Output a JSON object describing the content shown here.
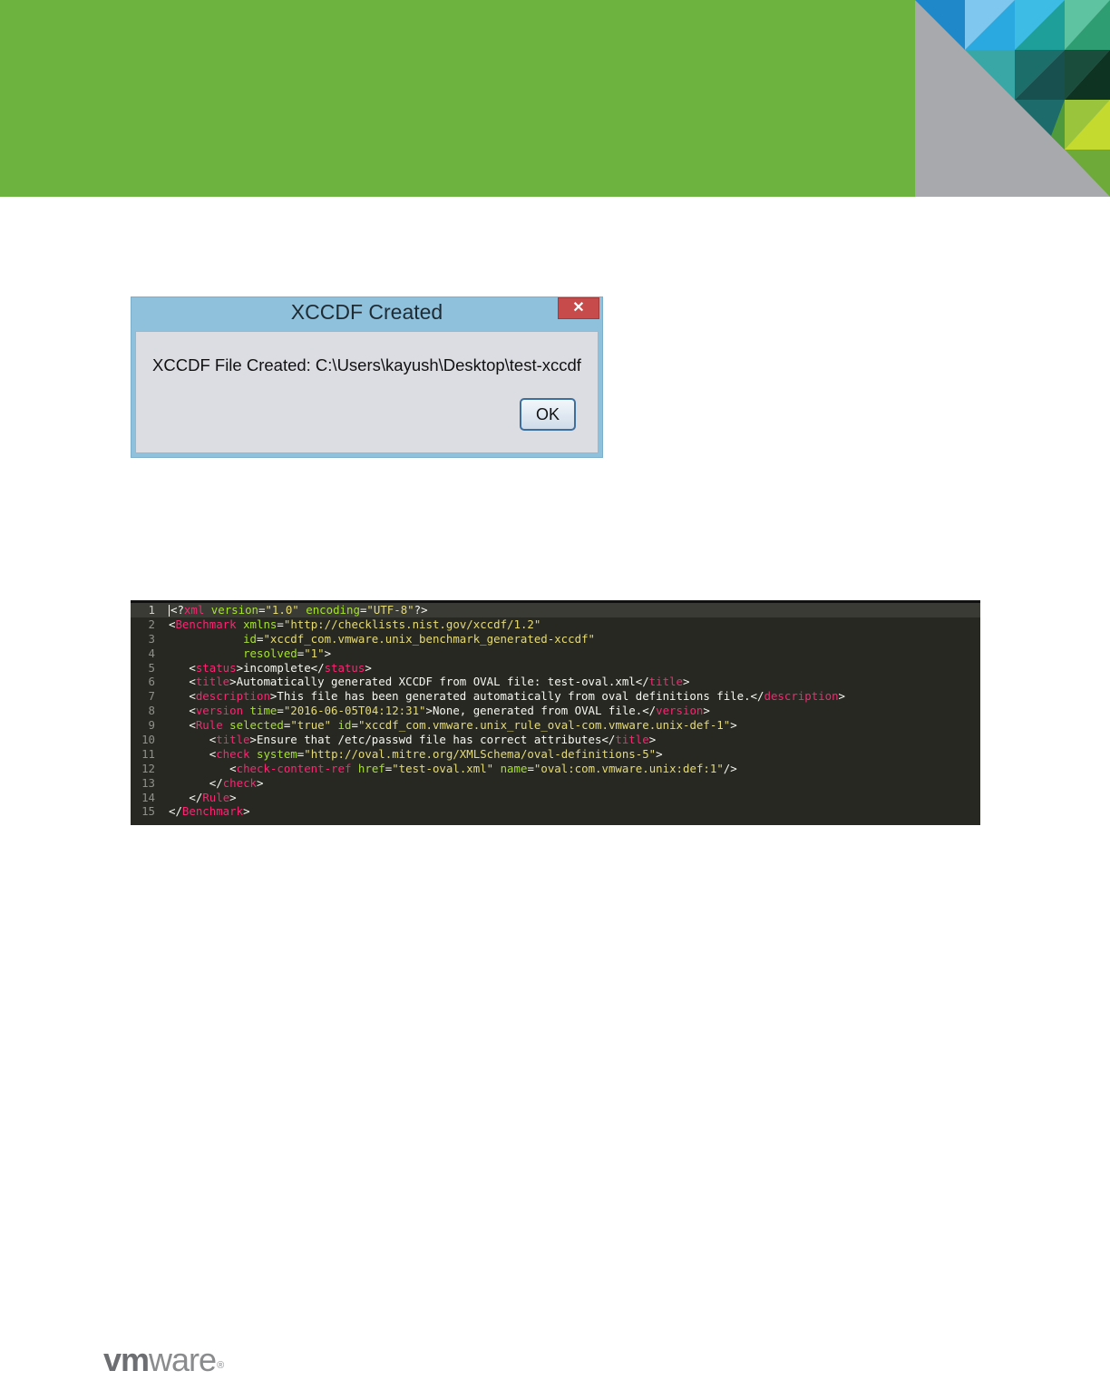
{
  "dialog": {
    "title": "XCCDF Created",
    "close_glyph": "✕",
    "message": "XCCDF File Created: C:\\Users\\kayush\\Desktop\\test-xccdf",
    "ok_label": "OK"
  },
  "code": {
    "active_line": 1,
    "lines": [
      {
        "n": "1",
        "tokens": [
          [
            "p",
            "<?"
          ],
          [
            "g",
            "xml"
          ],
          [
            "p",
            " "
          ],
          [
            "a",
            "version"
          ],
          [
            "p",
            "="
          ],
          [
            "s",
            "\"1.0\""
          ],
          [
            "p",
            " "
          ],
          [
            "a",
            "encoding"
          ],
          [
            "p",
            "="
          ],
          [
            "s",
            "\"UTF-8\""
          ],
          [
            "p",
            "?>"
          ]
        ]
      },
      {
        "n": "2",
        "tokens": [
          [
            "p",
            "<"
          ],
          [
            "t",
            "Benchmark"
          ],
          [
            "p",
            " "
          ],
          [
            "a",
            "xmlns"
          ],
          [
            "p",
            "="
          ],
          [
            "s",
            "\"http://checklists.nist.gov/xccdf/1.2\""
          ]
        ]
      },
      {
        "n": "3",
        "tokens": [
          [
            "p",
            "           "
          ],
          [
            "a",
            "id"
          ],
          [
            "p",
            "="
          ],
          [
            "s",
            "\"xccdf_com.vmware.unix_benchmark_generated-xccdf\""
          ]
        ]
      },
      {
        "n": "4",
        "tokens": [
          [
            "p",
            "           "
          ],
          [
            "a",
            "resolved"
          ],
          [
            "p",
            "="
          ],
          [
            "s",
            "\"1\""
          ],
          [
            "p",
            ">"
          ]
        ]
      },
      {
        "n": "5",
        "tokens": [
          [
            "p",
            "   <"
          ],
          [
            "t",
            "status"
          ],
          [
            "p",
            ">incomplete</"
          ],
          [
            "t",
            "status"
          ],
          [
            "p",
            ">"
          ]
        ]
      },
      {
        "n": "6",
        "tokens": [
          [
            "p",
            "   <"
          ],
          [
            "t",
            "title"
          ],
          [
            "p",
            ">Automatically generated XCCDF from OVAL file: test-oval.xml</"
          ],
          [
            "t",
            "title"
          ],
          [
            "p",
            ">"
          ]
        ]
      },
      {
        "n": "7",
        "tokens": [
          [
            "p",
            "   <"
          ],
          [
            "t",
            "description"
          ],
          [
            "p",
            ">This file has been generated automatically from oval definitions file.</"
          ],
          [
            "t",
            "description"
          ],
          [
            "p",
            ">"
          ]
        ]
      },
      {
        "n": "8",
        "tokens": [
          [
            "p",
            "   <"
          ],
          [
            "t",
            "version"
          ],
          [
            "p",
            " "
          ],
          [
            "a",
            "time"
          ],
          [
            "p",
            "="
          ],
          [
            "s",
            "\"2016-06-05T04:12:31\""
          ],
          [
            "p",
            ">None, generated from OVAL file.</"
          ],
          [
            "t",
            "version"
          ],
          [
            "p",
            ">"
          ]
        ]
      },
      {
        "n": "9",
        "tokens": [
          [
            "p",
            "   <"
          ],
          [
            "t",
            "Rule"
          ],
          [
            "p",
            " "
          ],
          [
            "a",
            "selected"
          ],
          [
            "p",
            "="
          ],
          [
            "s",
            "\"true\""
          ],
          [
            "p",
            " "
          ],
          [
            "a",
            "id"
          ],
          [
            "p",
            "="
          ],
          [
            "s",
            "\"xccdf_com.vmware.unix_rule_oval-com.vmware.unix-def-1\""
          ],
          [
            "p",
            ">"
          ]
        ]
      },
      {
        "n": "10",
        "tokens": [
          [
            "p",
            "      <"
          ],
          [
            "t",
            "title"
          ],
          [
            "p",
            ">Ensure that /etc/passwd file has correct attributes</"
          ],
          [
            "t",
            "title"
          ],
          [
            "p",
            ">"
          ]
        ]
      },
      {
        "n": "11",
        "tokens": [
          [
            "p",
            "      <"
          ],
          [
            "t",
            "check"
          ],
          [
            "p",
            " "
          ],
          [
            "a",
            "system"
          ],
          [
            "p",
            "="
          ],
          [
            "s",
            "\"http://oval.mitre.org/XMLSchema/oval-definitions-5\""
          ],
          [
            "p",
            ">"
          ]
        ]
      },
      {
        "n": "12",
        "tokens": [
          [
            "p",
            "         <"
          ],
          [
            "t",
            "check-content-ref"
          ],
          [
            "p",
            " "
          ],
          [
            "a",
            "href"
          ],
          [
            "p",
            "="
          ],
          [
            "s",
            "\"test-oval.xml\""
          ],
          [
            "p",
            " "
          ],
          [
            "a",
            "name"
          ],
          [
            "p",
            "="
          ],
          [
            "s",
            "\"oval:com.vmware.unix:def:1\""
          ],
          [
            "p",
            "/>"
          ]
        ]
      },
      {
        "n": "13",
        "tokens": [
          [
            "p",
            "      </"
          ],
          [
            "t",
            "check"
          ],
          [
            "p",
            ">"
          ]
        ]
      },
      {
        "n": "14",
        "tokens": [
          [
            "p",
            "   </"
          ],
          [
            "t",
            "Rule"
          ],
          [
            "p",
            ">"
          ]
        ]
      },
      {
        "n": "15",
        "tokens": [
          [
            "p",
            "</"
          ],
          [
            "t",
            "Benchmark"
          ],
          [
            "p",
            ">"
          ]
        ]
      }
    ]
  },
  "footer": {
    "logo_vm": "vm",
    "logo_ware": "ware",
    "logo_reg": "®"
  },
  "colors": {
    "header_green": "#6db33f",
    "code_bg": "#272822",
    "tag": "#f92672",
    "attr": "#a6e22e",
    "string": "#e6db74"
  }
}
